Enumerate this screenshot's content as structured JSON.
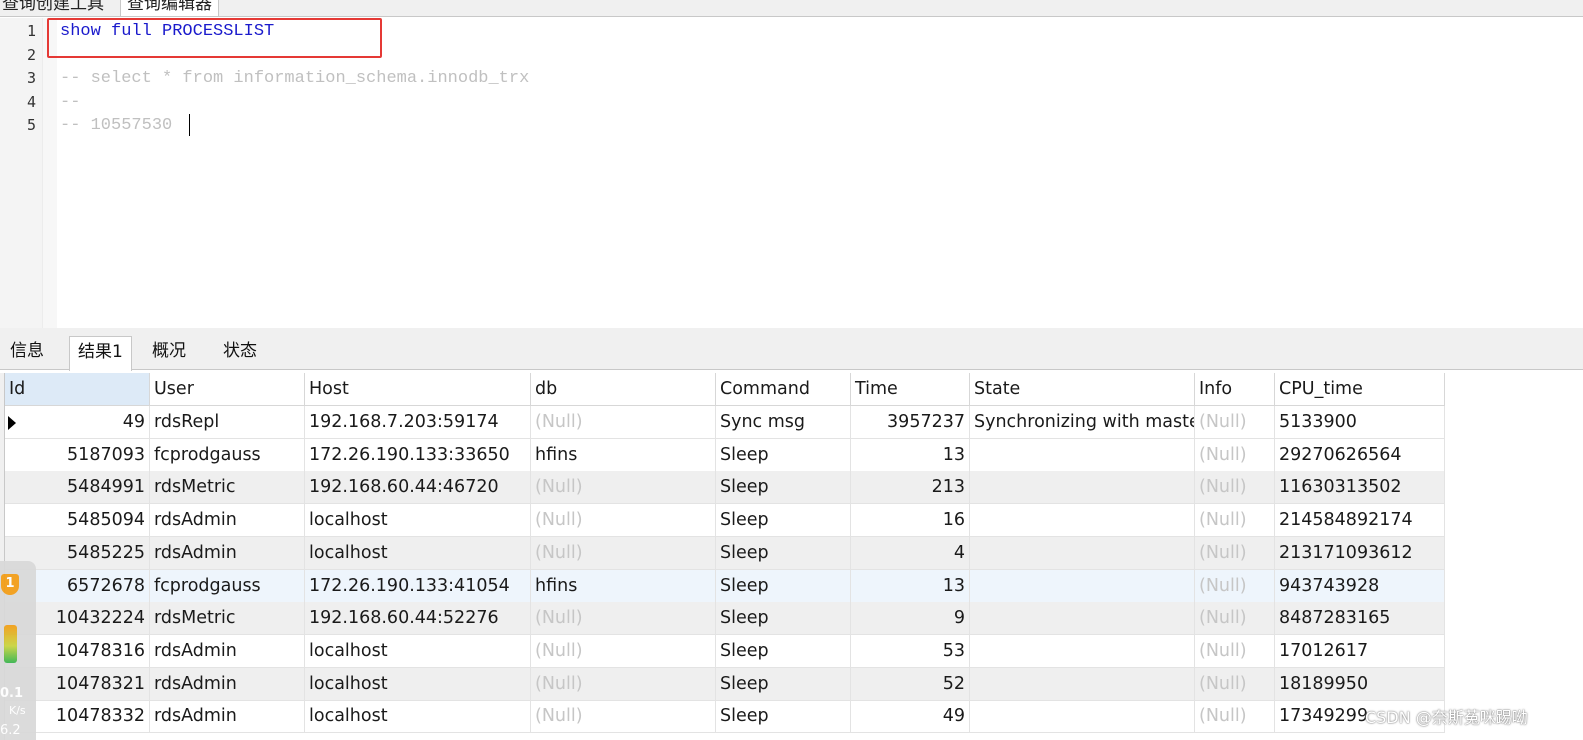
{
  "top_tabs": [
    "查询创建工具",
    "查询编辑器"
  ],
  "editor": {
    "lines": [
      {
        "no": "1",
        "text": "show full PROCESSLIST",
        "kind": "kw"
      },
      {
        "no": "2",
        "text": "",
        "kind": "kw"
      },
      {
        "no": "3",
        "text": "-- select * from information_schema.innodb_trx",
        "kind": "cm"
      },
      {
        "no": "4",
        "text": "--",
        "kind": "cm"
      },
      {
        "no": "5",
        "text": "-- 10557530",
        "kind": "cm"
      }
    ]
  },
  "result_tabs": [
    "信息",
    "结果1",
    "概况",
    "状态"
  ],
  "active_result_tab": "结果1",
  "grid": {
    "columns": [
      "Id",
      "User",
      "Host",
      "db",
      "Command",
      "Time",
      "State",
      "Info",
      "CPU_time"
    ],
    "rows": [
      [
        "49",
        "rdsRepl",
        "192.168.7.203:59174",
        "(Null)",
        "Sync msg",
        "3957237",
        "Synchronizing with maste",
        "(Null)",
        "5133900"
      ],
      [
        "5187093",
        "fcprodgauss",
        "172.26.190.133:33650",
        "hfins",
        "Sleep",
        "13",
        "",
        "(Null)",
        "29270626564"
      ],
      [
        "5484991",
        "rdsMetric",
        "192.168.60.44:46720",
        "(Null)",
        "Sleep",
        "213",
        "",
        "(Null)",
        "11630313502"
      ],
      [
        "5485094",
        "rdsAdmin",
        "localhost",
        "(Null)",
        "Sleep",
        "16",
        "",
        "(Null)",
        "214584892174"
      ],
      [
        "5485225",
        "rdsAdmin",
        "localhost",
        "(Null)",
        "Sleep",
        "4",
        "",
        "(Null)",
        "213171093612"
      ],
      [
        "6572678",
        "fcprodgauss",
        "172.26.190.133:41054",
        "hfins",
        "Sleep",
        "13",
        "",
        "(Null)",
        "943743928"
      ],
      [
        "10432224",
        "rdsMetric",
        "192.168.60.44:52276",
        "(Null)",
        "Sleep",
        "9",
        "",
        "(Null)",
        "8487283165"
      ],
      [
        "10478316",
        "rdsAdmin",
        "localhost",
        "(Null)",
        "Sleep",
        "53",
        "",
        "(Null)",
        "17012617"
      ],
      [
        "10478321",
        "rdsAdmin",
        "localhost",
        "(Null)",
        "Sleep",
        "52",
        "",
        "(Null)",
        "18189950"
      ],
      [
        "10478332",
        "rdsAdmin",
        "localhost",
        "(Null)",
        "Sleep",
        "49",
        "",
        "(Null)",
        "17349299"
      ]
    ]
  },
  "side_widget": {
    "badge": "1",
    "speed_value": "0.1",
    "speed_unit": "K/s",
    "speed_value2": "6.2"
  },
  "watermark": "CSDN @奈斯菟咪踢呦"
}
